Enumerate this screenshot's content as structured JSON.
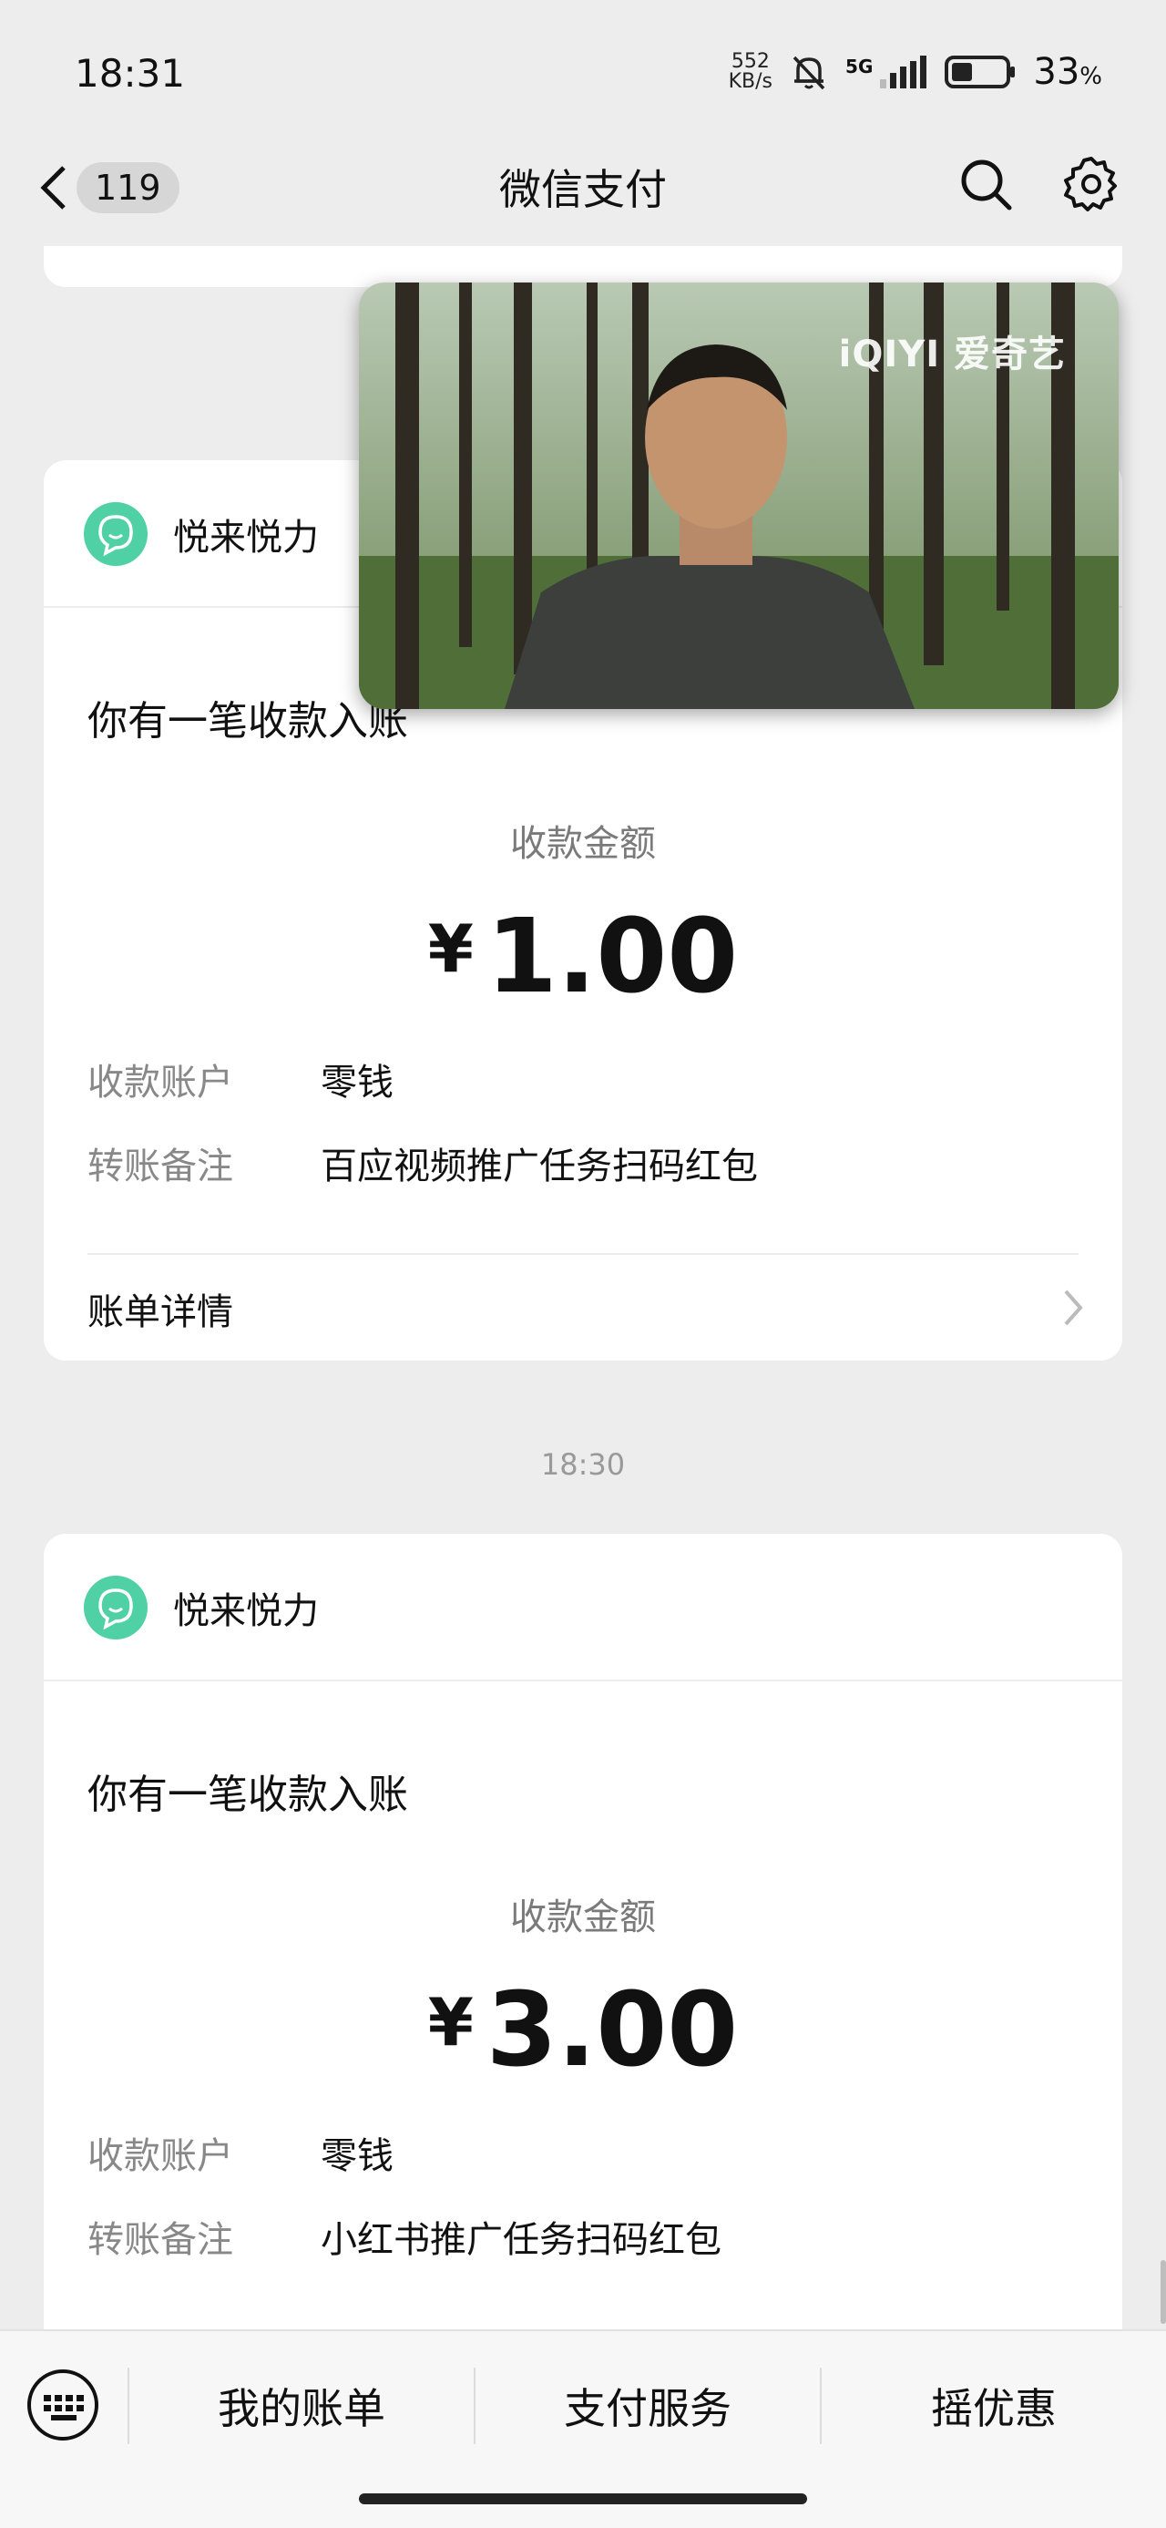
{
  "status": {
    "time": "18:31",
    "net_speed_value": "552",
    "net_speed_unit": "KB/s",
    "network": "5G",
    "battery_pct": "33",
    "battery_pct_symbol": "%"
  },
  "nav": {
    "unread_count": "119",
    "title": "微信支付"
  },
  "video": {
    "watermark": "iQIYI 爱奇艺"
  },
  "messages": [
    {
      "app_name": "悦来悦力",
      "headline": "你有一笔收款入账",
      "amount_label": "收款金额",
      "currency": "¥",
      "amount": "1.00",
      "account_label": "收款账户",
      "account_value": "零钱",
      "note_label": "转账备注",
      "note_value": "百应视频推广任务扫码红包",
      "detail_label": "账单详情"
    },
    {
      "timestamp": "18:30",
      "app_name": "悦来悦力",
      "headline": "你有一笔收款入账",
      "amount_label": "收款金额",
      "currency": "¥",
      "amount": "3.00",
      "account_label": "收款账户",
      "account_value": "零钱",
      "note_label": "转账备注",
      "note_value": "小红书推广任务扫码红包"
    }
  ],
  "bottom_tabs": [
    {
      "label": "我的账单"
    },
    {
      "label": "支付服务"
    },
    {
      "label": "摇优惠"
    }
  ],
  "colors": {
    "accent_green": "#4fd1a5",
    "background": "#ededed"
  },
  "icons": [
    "back-chevron-icon",
    "search-icon",
    "gear-icon",
    "mute-bell-icon",
    "signal-icon",
    "battery-icon",
    "chat-bubble-icon",
    "chevron-right-icon",
    "keyboard-icon"
  ]
}
